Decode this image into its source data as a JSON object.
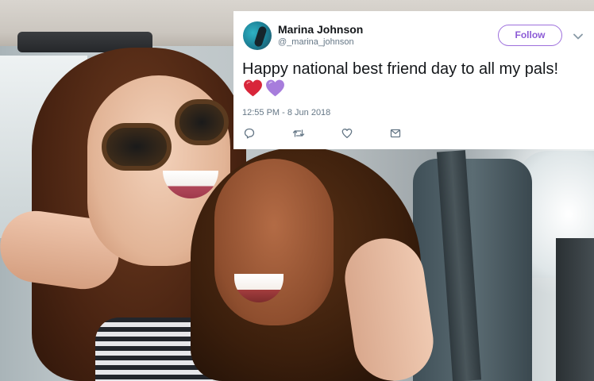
{
  "tweet": {
    "display_name": "Marina Johnson",
    "handle": "@_marina_johnson",
    "follow_label": "Follow",
    "text": "Happy national best friend day to all my pals!",
    "emojis": [
      "red-heart",
      "purple-heart"
    ],
    "timestamp": "12:55 PM - 8 Jun 2018",
    "actions": [
      "reply-icon",
      "retweet-icon",
      "like-icon",
      "direct-message-icon"
    ]
  },
  "colors": {
    "follow_accent": "#8c5bd6",
    "red_heart": "#d8263a",
    "purple_heart": "#a77ddc",
    "secondary_text": "#657786",
    "primary_text": "#14171a"
  }
}
